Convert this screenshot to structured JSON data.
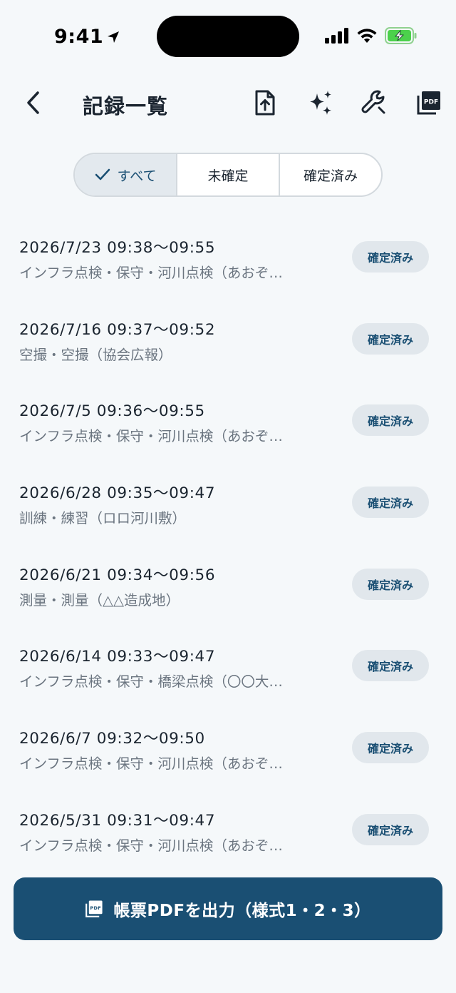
{
  "status_bar": {
    "time": "9:41"
  },
  "header": {
    "title": "記録一覧",
    "icons": [
      "upload-file-icon",
      "sparkles-icon",
      "wrench-icon",
      "pdf-icon"
    ]
  },
  "filter": {
    "segments": [
      {
        "label": "すべて",
        "active": true
      },
      {
        "label": "未確定",
        "active": false
      },
      {
        "label": "確定済み",
        "active": false
      }
    ]
  },
  "records": [
    {
      "date": "2026/7/23  09:38〜09:55",
      "summary": "インフラ点検・保守・河川点検（あおぞ…",
      "status": "確定済み"
    },
    {
      "date": "2026/7/16  09:37〜09:52",
      "summary": "空撮・空撮（協会広報）",
      "status": "確定済み"
    },
    {
      "date": "2026/7/5  09:36〜09:55",
      "summary": "インフラ点検・保守・河川点検（あおぞ…",
      "status": "確定済み"
    },
    {
      "date": "2026/6/28  09:35〜09:47",
      "summary": "訓練・練習（ロロ河川敷）",
      "status": "確定済み"
    },
    {
      "date": "2026/6/21  09:34〜09:56",
      "summary": "測量・測量（△△造成地）",
      "status": "確定済み"
    },
    {
      "date": "2026/6/14  09:33〜09:47",
      "summary": "インフラ点検・保守・橋梁点検（〇〇大…",
      "status": "確定済み"
    },
    {
      "date": "2026/6/7  09:32〜09:50",
      "summary": "インフラ点検・保守・河川点検（あおぞ…",
      "status": "確定済み"
    },
    {
      "date": "2026/5/31  09:31〜09:47",
      "summary": "インフラ点検・保守・河川点検（あおぞ…",
      "status": "確定済み"
    }
  ],
  "export_button": {
    "label": "帳票PDFを出力（様式1・2・3）"
  },
  "colors": {
    "accent": "#1a4f73",
    "badge_bg": "#e1e7ec",
    "background": "#f5f8fa"
  }
}
